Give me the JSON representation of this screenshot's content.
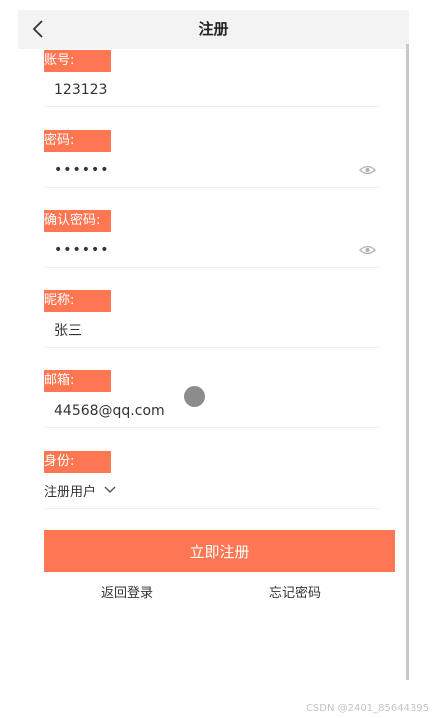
{
  "header": {
    "title": "注册",
    "back_icon": "chevron-left-icon"
  },
  "form": {
    "account": {
      "label": "账号:",
      "value": "123123"
    },
    "password": {
      "label": "密码:",
      "value": "••••••"
    },
    "confirm_password": {
      "label": "确认密码:",
      "value": "••••••"
    },
    "nickname": {
      "label": "昵称:",
      "value": "张三"
    },
    "email": {
      "label": "邮箱:",
      "value": "44568@qq.com"
    },
    "role": {
      "label": "身份:",
      "value": "注册用户"
    }
  },
  "actions": {
    "register": "立即注册",
    "back_to_login": "返回登录",
    "forgot_password": "忘记密码"
  },
  "watermark": "CSDN @2401_85644395",
  "colors": {
    "accent": "#ff7752",
    "nav_bg": "#f3f3f3",
    "divider": "#ececec"
  }
}
